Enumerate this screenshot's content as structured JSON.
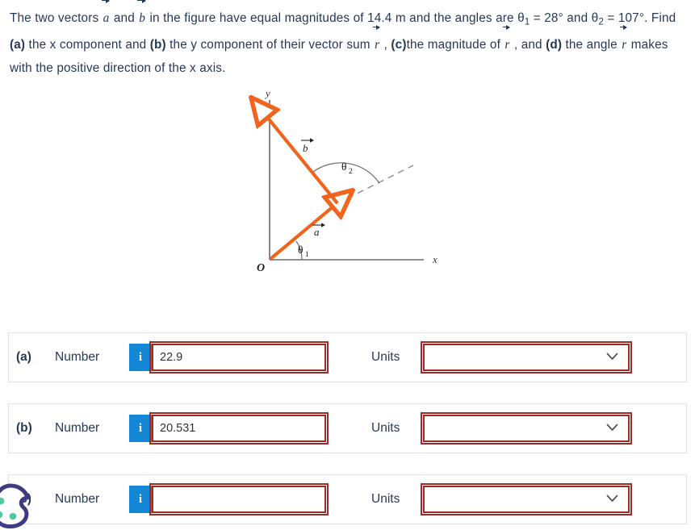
{
  "problem": {
    "line1_a": "The two vectors ",
    "vec_a": "a",
    "line1_b": " and ",
    "vec_b": "b",
    "line1_c": " in the figure have equal magnitudes of 14.4 m and the angles are ",
    "theta_symbol": "θ",
    "theta1_sub": "1",
    "line1_d": " = ",
    "line2_a": "28° and ",
    "theta2_sub": "2",
    "line2_b": " = 107°. Find ",
    "bold_a": "(a)",
    "line2_c": " the x component and ",
    "bold_b": "(b)",
    "line2_d": " the y component of their vector sum ",
    "vec_r": "r",
    "line2_e": " , ",
    "bold_c": "(c)",
    "line3_a": "the magnitude of ",
    "line3_b": " , and ",
    "bold_d": "(d)",
    "line3_c": " the angle ",
    "line3_d": " makes with the positive direction of the x axis.",
    "magnitude": "14.4 m",
    "theta1_value": "28°",
    "theta2_value": "107°"
  },
  "figure": {
    "axis_label_x": "x",
    "axis_label_y": "y",
    "origin_label": "O",
    "vector_a_label": "a",
    "vector_b_label": "b",
    "angle1_label": "θ",
    "angle1_sub": "1",
    "angle2_label": "θ",
    "angle2_sub": "2",
    "vector_color": "#f0641e",
    "axis_color": "#6b6b6b",
    "dashed_color": "#8a8a8a"
  },
  "answers": {
    "number_label": "Number",
    "units_label": "Units",
    "info_glyph": "i",
    "rows": [
      {
        "part": "(a)",
        "value": "22.9",
        "placeholder": "",
        "units_value": "",
        "border_color": "#9e2b25"
      },
      {
        "part": "(b)",
        "value": "20.531",
        "placeholder": "",
        "units_value": "",
        "border_color": "#9e2b25"
      },
      {
        "part": "(c)",
        "value": "",
        "placeholder": "",
        "units_value": "",
        "border_color": "#9e2b25"
      }
    ]
  },
  "cookie_widget": {
    "outline_color": "#3f3b80",
    "dot_color": "#4ec9a0"
  }
}
